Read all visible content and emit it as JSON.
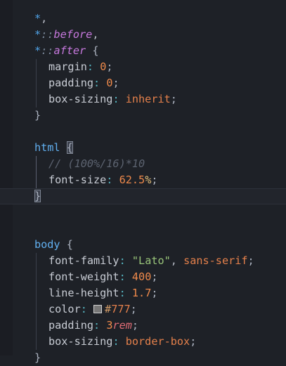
{
  "editor": {
    "lines": {
      "l1_sel": "*",
      "l1_comma": ",",
      "l2_star": "*",
      "l2_colons": "::",
      "l2_pseudo": "before",
      "l2_comma": ",",
      "l3_star": "*",
      "l3_colons": "::",
      "l3_pseudo": "after",
      "l3_brace": "{",
      "margin_prop": "margin",
      "margin_val": "0",
      "padding_prop": "padding",
      "padding_val": "0",
      "bs_prop": "box-sizing",
      "bs_val": "inherit",
      "close1": "}",
      "html_sel": "html",
      "html_brace": "{",
      "comment": "// (100%/16)*10",
      "fs_prop": "font-size",
      "fs_num": "62.5",
      "fs_pct": "%",
      "close2": "}",
      "body_sel": "body",
      "body_brace": "{",
      "ff_prop": "font-family",
      "ff_str": "\"Lato\"",
      "ff_comma": ",",
      "ff_kw": "sans-serif",
      "fw_prop": "font-weight",
      "fw_val": "400",
      "lh_prop": "line-height",
      "lh_val": "1.7",
      "color_prop": "color",
      "color_hash": "#",
      "color_hex": "777",
      "pad_prop": "padding",
      "pad_num": "3",
      "pad_unit": "rem",
      "bs2_prop": "box-sizing",
      "bs2_val": "border-box",
      "close3": "}"
    },
    "colon": ":",
    "semicolon": ";",
    "swatch_color": "#777777"
  }
}
